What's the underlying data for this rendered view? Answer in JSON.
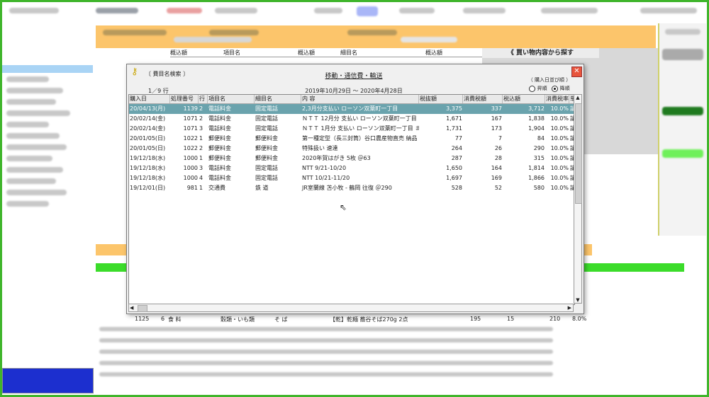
{
  "background": {
    "columns_behind": [
      "概込額",
      "項目名",
      "概込額",
      "細目名",
      "概込額"
    ],
    "panel_title": "《 買い物内容から探す",
    "visible_row": {
      "no": "1125",
      "row": "6",
      "item": "食 料",
      "sub": "穀類・いも類",
      "name": "そ ば",
      "content": "【乾】乾麺 蕎谷そば270g 2点",
      "v1": "195",
      "v2": "15",
      "v3": "210",
      "rate": "8.0%",
      "mark": "ツ"
    }
  },
  "dialog": {
    "search_label": "〔 費目名検索 〕",
    "title": "移動・通信費・輸送",
    "period": "2019年10月29日 ～ 2020年4月28日",
    "row_count": "1／9 行",
    "sort": {
      "title": "（ 購入日並び順 ）",
      "asc": "昇順",
      "desc": "降順",
      "selected": "desc"
    },
    "columns": [
      "購入日",
      "処理番号",
      "行",
      "項目名",
      "細目名",
      "内 容",
      "税抜額",
      "消費税額",
      "税込額",
      "消費税率",
      "単"
    ],
    "rows": [
      {
        "date": "20/04/13(月)",
        "no": "1139",
        "line": "2",
        "item": "電話料金",
        "sub": "固定電話",
        "content": "2,3月分支払い ローソン双葉町一丁目",
        "net": "3,375",
        "tax": "337",
        "gross": "3,712",
        "rate": "10.0%",
        "unit": "議"
      },
      {
        "date": "20/02/14(金)",
        "no": "1071",
        "line": "2",
        "item": "電話料金",
        "sub": "固定電話",
        "content": "ＮＴＴ 12月分 支払い ローソン双葉町一丁目",
        "net": "1,671",
        "tax": "167",
        "gross": "1,838",
        "rate": "10.0%",
        "unit": "議"
      },
      {
        "date": "20/02/14(金)",
        "no": "1071",
        "line": "3",
        "item": "電話料金",
        "sub": "固定電話",
        "content": "ＮＴＴ 1月分 支払い ローソン双葉町一丁目 ＃",
        "net": "1,731",
        "tax": "173",
        "gross": "1,904",
        "rate": "10.0%",
        "unit": "議"
      },
      {
        "date": "20/01/05(日)",
        "no": "1022",
        "line": "1",
        "item": "郵便料金",
        "sub": "郵便料金",
        "content": "第一種定型（長三封筒）谷口農産物直売 納品",
        "net": "77",
        "tax": "7",
        "gross": "84",
        "rate": "10.0%",
        "unit": "議"
      },
      {
        "date": "20/01/05(日)",
        "no": "1022",
        "line": "2",
        "item": "郵便料金",
        "sub": "郵便料金",
        "content": "特殊扱い 速達",
        "net": "264",
        "tax": "26",
        "gross": "290",
        "rate": "10.0%",
        "unit": "議"
      },
      {
        "date": "19/12/18(水)",
        "no": "1000",
        "line": "1",
        "item": "郵便料金",
        "sub": "郵便料金",
        "content": "2020年賀はがき 5枚 ＠63",
        "net": "287",
        "tax": "28",
        "gross": "315",
        "rate": "10.0%",
        "unit": "議"
      },
      {
        "date": "19/12/18(水)",
        "no": "1000",
        "line": "3",
        "item": "電話料金",
        "sub": "固定電話",
        "content": "NTT 9/21-10/20",
        "net": "1,650",
        "tax": "164",
        "gross": "1,814",
        "rate": "10.0%",
        "unit": "議"
      },
      {
        "date": "19/12/18(水)",
        "no": "1000",
        "line": "4",
        "item": "電話料金",
        "sub": "固定電話",
        "content": "NTT 10/21-11/20",
        "net": "1,697",
        "tax": "169",
        "gross": "1,866",
        "rate": "10.0%",
        "unit": "議"
      },
      {
        "date": "19/12/01(日)",
        "no": "981",
        "line": "1",
        "item": "交通費",
        "sub": "鉄 道",
        "content": "JR室蘭線 苫小牧 - 鶴岡 往復 ＠290",
        "net": "528",
        "tax": "52",
        "gross": "580",
        "rate": "10.0%",
        "unit": "議"
      }
    ]
  },
  "colors": {
    "frame": "#3fb52b",
    "orange": "#fcc56b",
    "selected_row": "#6aa3ad",
    "green_bar": "#3bdc2a",
    "blue_box": "#1c2fcf"
  }
}
